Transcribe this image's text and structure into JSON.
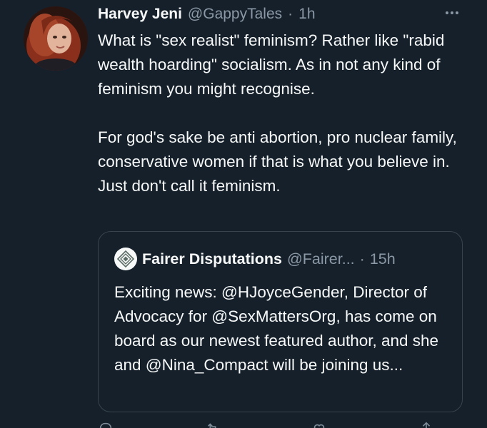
{
  "tweet": {
    "display_name": "Harvey Jeni",
    "handle": "@GappyTales",
    "separator": "·",
    "time": "1h",
    "more_icon": "more-horizontal-icon",
    "paragraphs": [
      "What is \"sex realist\" feminism? Rather like \"rabid wealth hoarding\" socialism. As in not any kind of feminism you might recognise.",
      "For god's sake be anti abortion, pro nuclear family, conservative women if that is what you believe in. Just don't call it feminism."
    ]
  },
  "quote": {
    "display_name": "Fairer Disputations",
    "handle": "@Fairer...",
    "separator": "·",
    "time": "15h",
    "avatar_icon": "diamond-logo-icon",
    "text": "Exciting news: @HJoyceGender, Director of Advocacy for @SexMattersOrg, has come on board as our newest featured author, and she and @Nina_Compact will be joining us..."
  },
  "actions": [
    "reply-icon",
    "retweet-icon",
    "like-icon",
    "share-icon"
  ],
  "colors": {
    "background": "#15202b",
    "text": "#f7f9f9",
    "secondary": "#8b98a5",
    "border": "#38444d"
  }
}
